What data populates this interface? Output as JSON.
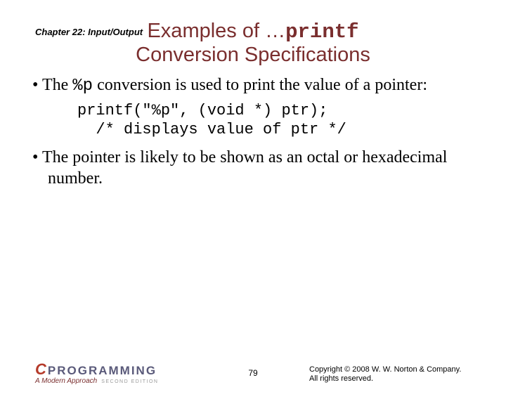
{
  "chapter": "Chapter 22: Input/Output",
  "title": {
    "pre": "Examples of ",
    "ellipsis": "…",
    "code": "printf",
    "line2": "Conversion Specifications"
  },
  "bullets": [
    {
      "pre": "The ",
      "code": "%p",
      "post": " conversion is used to print the value of a pointer:"
    },
    {
      "text": "The pointer is likely to be shown as an octal or hexadecimal number."
    }
  ],
  "code": {
    "l1": "printf(\"%p\", (void *) ptr);",
    "l2": "  /* displays value of ptr */"
  },
  "logo": {
    "c": "C",
    "prog": "PROGRAMMING",
    "sub": "A Modern Approach",
    "ed": "SECOND EDITION"
  },
  "pagenum": "79",
  "copyright": {
    "l1": "Copyright © 2008 W. W. Norton & Company.",
    "l2": "All rights reserved."
  }
}
